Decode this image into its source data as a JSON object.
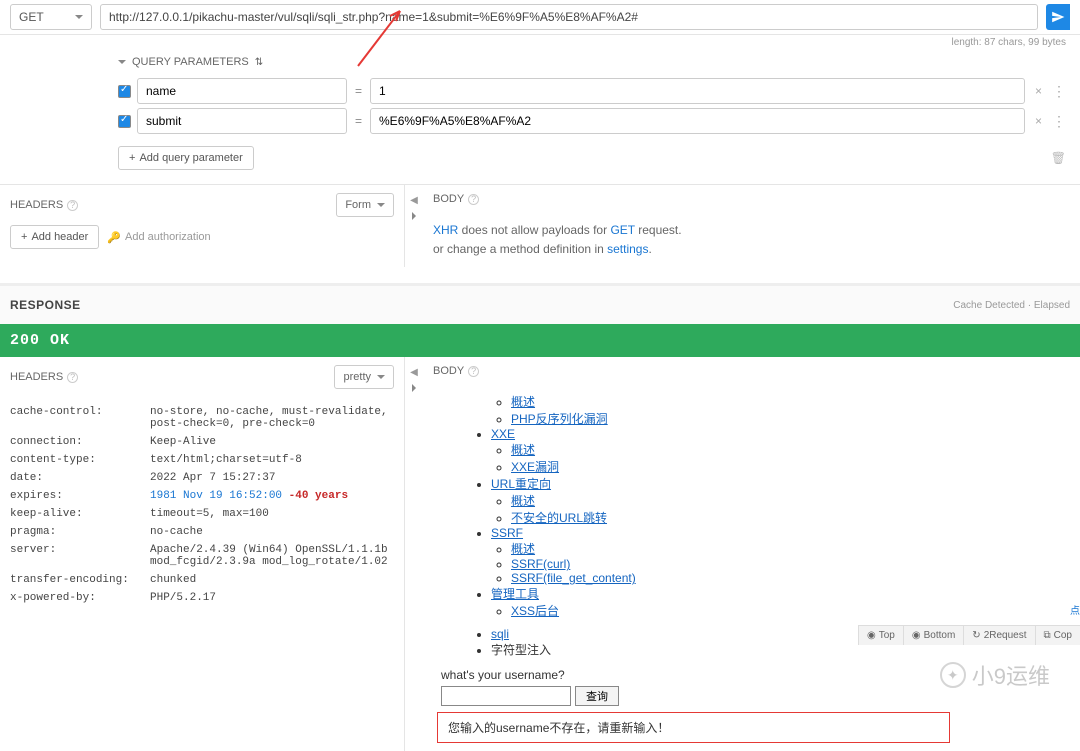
{
  "request": {
    "method": "GET",
    "url": "http://127.0.0.1/pikachu-master/vul/sqli/sqli_str.php?name=1&submit=%E6%9F%A5%E8%AF%A2#",
    "length_info": "length: 87 chars, 99 bytes"
  },
  "query_params": {
    "title": "QUERY PARAMETERS",
    "items": [
      {
        "name": "name",
        "value": "1"
      },
      {
        "name": "submit",
        "value": "%E6%9F%A5%E8%AF%A2"
      }
    ],
    "add_btn": "Add query parameter"
  },
  "req_headers": {
    "title": "HEADERS",
    "form_label": "Form",
    "add_header": "Add header",
    "add_auth": "Add authorization"
  },
  "req_body": {
    "title": "BODY",
    "line1_pre": "XHR",
    "line1_mid": " does not allow payloads for ",
    "line1_get": "GET",
    "line1_end": " request.",
    "line2_pre": "or change a method definition in ",
    "line2_link": "settings",
    "line2_end": "."
  },
  "response": {
    "title": "RESPONSE",
    "meta": "Cache Detected · Elapsed",
    "status": "200 OK"
  },
  "resp_headers": {
    "title": "HEADERS",
    "pretty": "pretty",
    "rows": [
      {
        "k": "cache-control:",
        "v": "no-store, no-cache, must-revalidate, post-check=0, pre-check=0"
      },
      {
        "k": "connection:",
        "v": "Keep-Alive"
      },
      {
        "k": "content-type:",
        "v": "text/html;charset=utf-8"
      },
      {
        "k": "date:",
        "v": "2022 Apr 7 15:27:37"
      },
      {
        "k": "expires:",
        "v_blue": "1981 Nov 19 16:52:00",
        "v_red": " -40 years"
      },
      {
        "k": "keep-alive:",
        "v": "timeout=5, max=100"
      },
      {
        "k": "pragma:",
        "v": "no-cache"
      },
      {
        "k": "server:",
        "v": "Apache/2.4.39 (Win64) OpenSSL/1.1.1b mod_fcgid/2.3.9a mod_log_rotate/1.02"
      },
      {
        "k": "transfer-encoding:",
        "v": "chunked"
      },
      {
        "k": "x-powered-by:",
        "v": "PHP/5.2.17"
      }
    ]
  },
  "resp_body": {
    "title": "BODY",
    "links": {
      "gaishu0": "概述",
      "phpdeser": "PHP反序列化漏洞",
      "xxe": "XXE",
      "gaishu1": "概述",
      "xxeloudong": "XXE漏洞",
      "urlredir": "URL重定向",
      "gaishu2": "概述",
      "unsafeurl": "不安全的URL跳转",
      "ssrf": "SSRF",
      "gaishu3": "概述",
      "ssrfcurl": "SSRF(curl)",
      "ssrffgc": "SSRF(file_get_content)",
      "mgmt": "管理工具",
      "xssadmin": "XSS后台",
      "sqli": "sqli",
      "strinj": "字符型注入"
    },
    "prompt": "what's your username?",
    "search_btn": "查询",
    "error_msg": "您输入的username不存在，请重新输入！"
  },
  "watermark": "小9运维",
  "footer": {
    "top": "Top",
    "bottom": "Bottom",
    "request": "2Request",
    "copy": "Cop"
  },
  "right_crumb": "点"
}
